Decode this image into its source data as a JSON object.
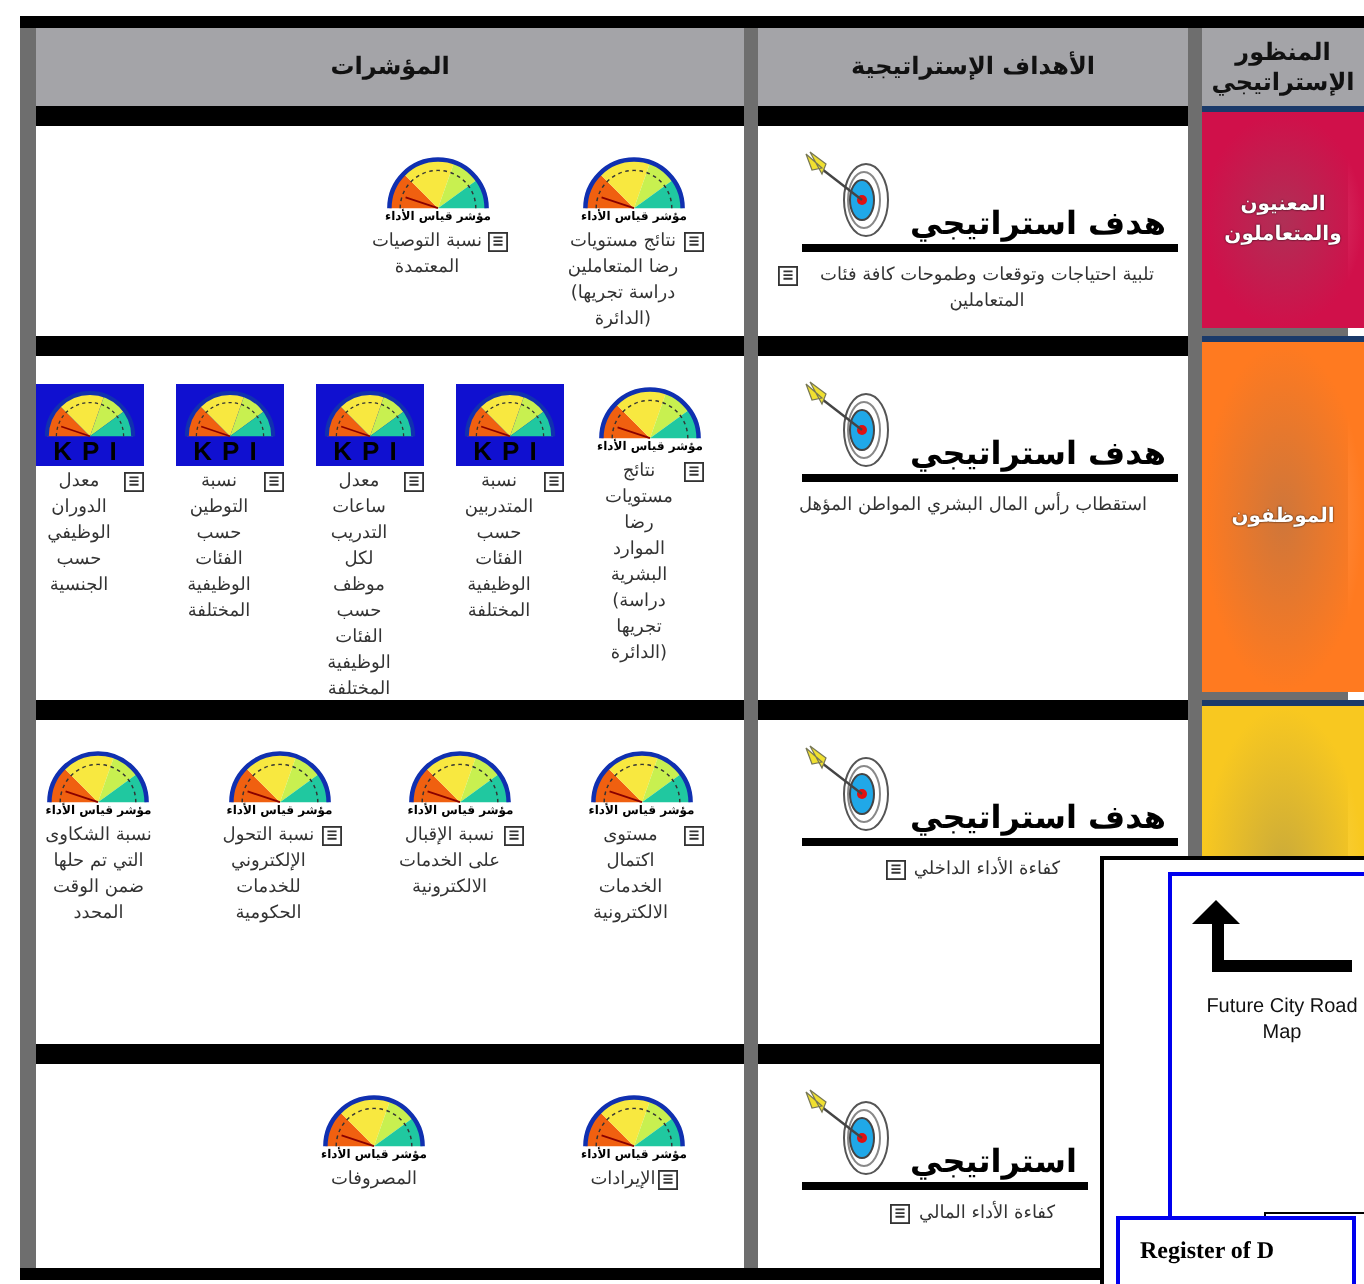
{
  "headers": {
    "indicators": "المؤشرات",
    "objectives": "الأهداف الإستراتيجية",
    "perspective": "المنظور الإستراتيجي"
  },
  "rows": [
    {
      "perspective": {
        "label": "المعنيون والمتعاملون",
        "color": "#d0104a"
      },
      "objective": {
        "title": "هدف استراتيجي",
        "text": "تلبية احتياجات وتوقعات وطموحات كافة فئات المتعاملين",
        "note": true
      },
      "indicators": [
        {
          "kind": "meter",
          "caption": "مؤشر قياس الأداء",
          "text": "نتائج مستويات رضا المتعاملين دراسة تجريها) (الدائرة",
          "note": true
        },
        {
          "kind": "meter",
          "caption": "مؤشر قياس الأداء",
          "text": "نسبة التوصيات المعتمدة",
          "note": true
        }
      ]
    },
    {
      "perspective": {
        "label": "الموظفون",
        "color": "#ff7a20"
      },
      "objective": {
        "title": "هدف استراتيجي",
        "text": "استقطاب رأس المال البشري المواطن المؤهل",
        "note": false
      },
      "indicators": [
        {
          "kind": "meter",
          "caption": "مؤشر قياس الأداء",
          "text": "نتائج مستويات رضا الموارد البشرية دراسة) تجريها (الدائرة",
          "note": true
        },
        {
          "kind": "kpi",
          "caption": "KPI",
          "text": "نسبة المتدربين حسب الفئات الوظيفية المختلفة",
          "note": true
        },
        {
          "kind": "kpi",
          "caption": "KPI",
          "text": "معدل ساعات التدريب لكل موظف حسب الفئات الوظيفية المختلفة",
          "note": true
        },
        {
          "kind": "kpi",
          "caption": "KPI",
          "text": "نسبة التوطين حسب الفئات الوظيفية المختلفة",
          "note": true
        },
        {
          "kind": "kpi",
          "caption": "KPI",
          "text": "معدل الدوران الوظيفي حسب الجنسية",
          "note": true
        }
      ]
    },
    {
      "perspective": {
        "color": "#f8c820"
      },
      "objective": {
        "title": "هدف استراتيجي",
        "text": "كفاءة الأداء الداخلي",
        "note": true
      },
      "indicators": [
        {
          "kind": "meter",
          "caption": "مؤشر قياس الأداء",
          "text": "مستوى اكتمال الخدمات الالكترونية",
          "note": true
        },
        {
          "kind": "meter",
          "caption": "مؤشر قياس الأداء",
          "text": "نسبة الإقبال على الخدمات الالكترونية",
          "note": true
        },
        {
          "kind": "meter",
          "caption": "مؤشر قياس الأداء",
          "text": "نسبة التحول الإلكتروني للخدمات الحكومية",
          "note": true
        },
        {
          "kind": "meter",
          "caption": "مؤشر قياس الأداء",
          "text": "نسبة الشكاوى التي تم حلها ضمن الوقت المحدد",
          "note": false
        }
      ]
    },
    {
      "objective": {
        "title": "استراتيجي",
        "text": "كفاءة الأداء المالي",
        "note": true
      },
      "indicators": [
        {
          "kind": "meter",
          "caption": "مؤشر قياس الأداء",
          "text": "الإيرادات",
          "note": true
        },
        {
          "kind": "meter",
          "caption": "مؤشر قياس الأداء",
          "text": "المصروفات",
          "note": false
        }
      ]
    }
  ],
  "overlay": {
    "title": "Future City Road Map",
    "box": "Register of D"
  }
}
